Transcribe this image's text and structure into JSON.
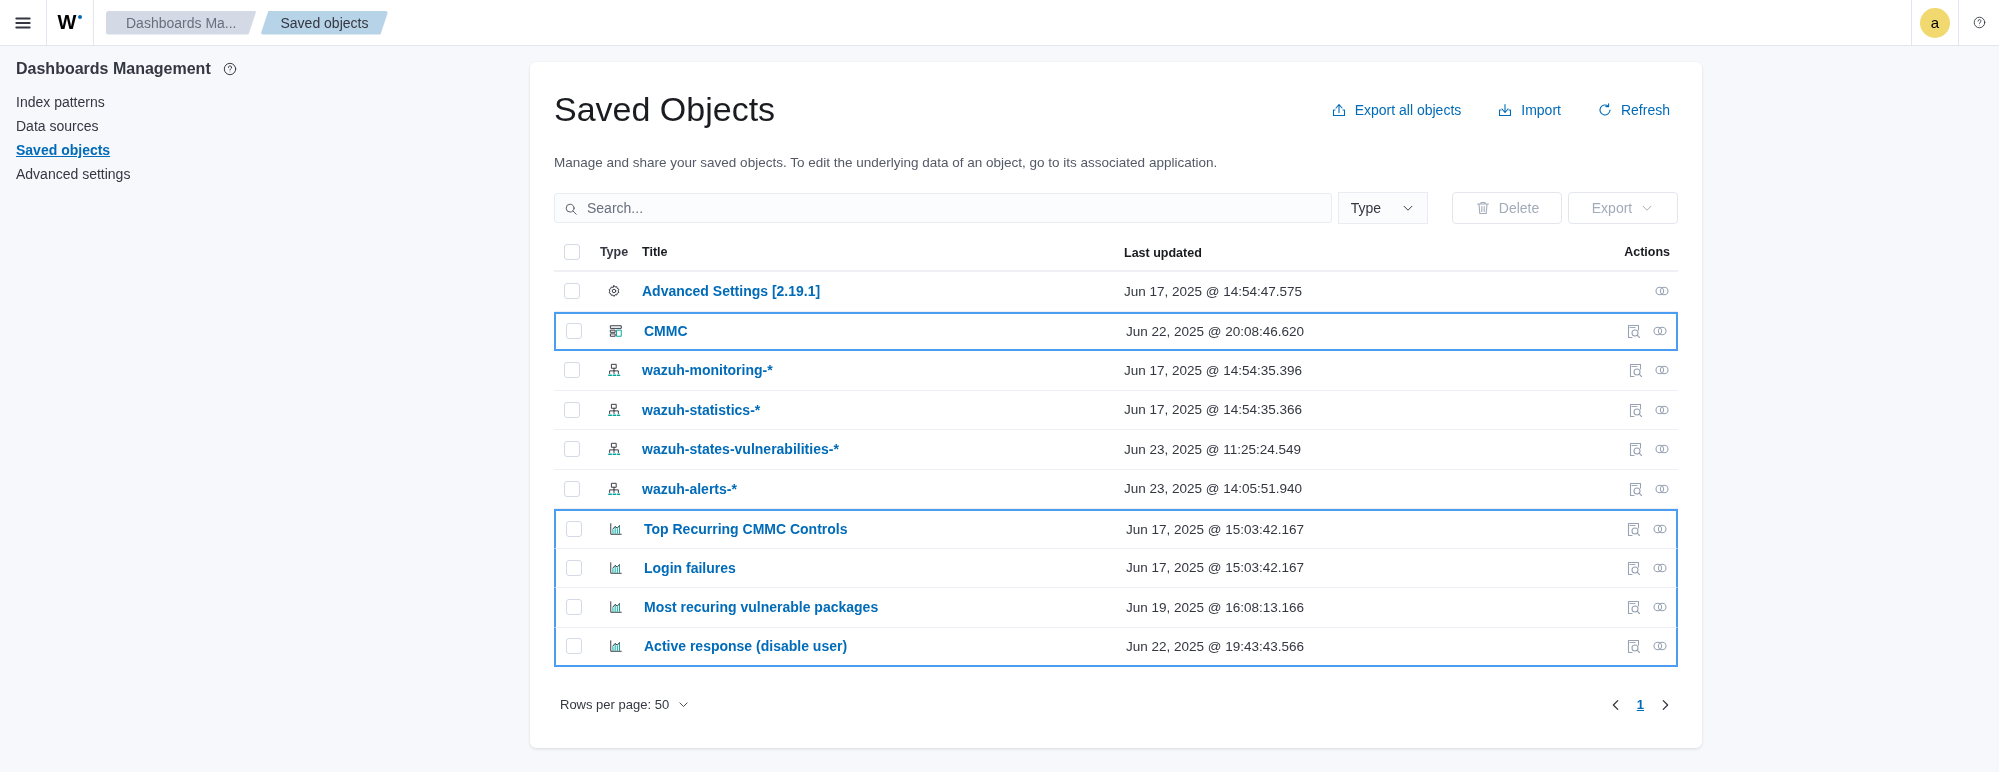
{
  "header": {
    "logo": "W",
    "breadcrumbs": [
      {
        "label": "Dashboards Ma...",
        "selected": false
      },
      {
        "label": "Saved objects",
        "selected": true
      }
    ],
    "avatar": "a"
  },
  "sidebar": {
    "title": "Dashboards Management",
    "items": [
      {
        "label": "Index patterns",
        "selected": false
      },
      {
        "label": "Data sources",
        "selected": false
      },
      {
        "label": "Saved objects",
        "selected": true
      },
      {
        "label": "Advanced settings",
        "selected": false
      }
    ]
  },
  "page": {
    "title": "Saved Objects",
    "actions": [
      {
        "label": "Export all objects",
        "kind": "export"
      },
      {
        "label": "Import",
        "kind": "import"
      },
      {
        "label": "Refresh",
        "kind": "refresh"
      }
    ],
    "description": "Manage and share your saved objects. To edit the underlying data of an object, go to its associated application.",
    "search": {
      "placeholder": "Search..."
    },
    "type_filter": "Type",
    "delete_button": {
      "label": "Delete",
      "disabled": true
    },
    "export_button": {
      "label": "Export",
      "disabled": true
    },
    "table": {
      "select_all_checked": false,
      "columns": [
        "Type",
        "Title",
        "Last updated",
        "Actions"
      ],
      "rows": [
        {
          "kind": "config",
          "title": "Advanced Settings [2.19.1]",
          "updated": "Jun 17, 2025 @ 14:54:47.575",
          "checked": false,
          "inspect": false,
          "highlighted": false
        },
        {
          "kind": "dashboard",
          "title": "CMMC",
          "updated": "Jun 22, 2025 @ 20:08:46.620",
          "checked": false,
          "inspect": true,
          "highlighted": true
        },
        {
          "kind": "index-pattern",
          "title": "wazuh-monitoring-*",
          "updated": "Jun 17, 2025 @ 14:54:35.396",
          "checked": false,
          "inspect": true,
          "highlighted": false
        },
        {
          "kind": "index-pattern",
          "title": "wazuh-statistics-*",
          "updated": "Jun 17, 2025 @ 14:54:35.366",
          "checked": false,
          "inspect": true,
          "highlighted": false
        },
        {
          "kind": "index-pattern",
          "title": "wazuh-states-vulnerabilities-*",
          "updated": "Jun 23, 2025 @ 11:25:24.549",
          "checked": false,
          "inspect": true,
          "highlighted": false
        },
        {
          "kind": "index-pattern",
          "title": "wazuh-alerts-*",
          "updated": "Jun 23, 2025 @ 14:05:51.940",
          "checked": false,
          "inspect": true,
          "highlighted": false
        },
        {
          "kind": "visualization",
          "title": "Top Recurring CMMC Controls",
          "updated": "Jun 17, 2025 @ 15:03:42.167",
          "checked": false,
          "inspect": true,
          "highlighted": true
        },
        {
          "kind": "visualization",
          "title": "Login failures",
          "updated": "Jun 17, 2025 @ 15:03:42.167",
          "checked": false,
          "inspect": true,
          "highlighted": true
        },
        {
          "kind": "visualization",
          "title": "Most recuring vulnerable packages",
          "updated": "Jun 19, 2025 @ 16:08:13.166",
          "checked": false,
          "inspect": true,
          "highlighted": true
        },
        {
          "kind": "visualization",
          "title": "Active response (disable user)",
          "updated": "Jun 22, 2025 @ 19:43:43.566",
          "checked": false,
          "inspect": true,
          "highlighted": true
        }
      ]
    },
    "rows_per_page": "Rows per page: 50",
    "pages": [
      {
        "label": "1",
        "selected": true
      }
    ]
  }
}
